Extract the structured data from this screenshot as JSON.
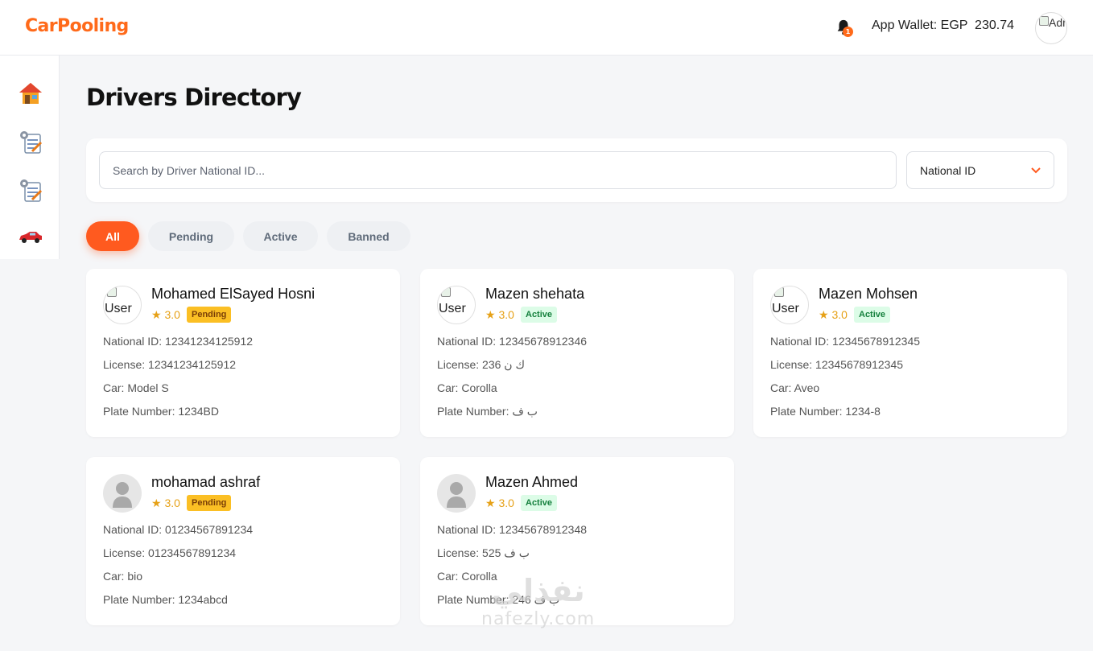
{
  "app": {
    "logo": "CarPooling"
  },
  "header": {
    "wallet_label": "App Wallet: EGP  230.74",
    "notification_count": "1",
    "admin_avatar_alt": "Admin"
  },
  "sidebar": {
    "items": [
      {
        "icon": "home-icon"
      },
      {
        "icon": "settings-clipboard-icon"
      },
      {
        "icon": "settings-clipboard-icon"
      },
      {
        "icon": "car-icon"
      }
    ]
  },
  "page": {
    "title": "Drivers Directory"
  },
  "search": {
    "placeholder": "Search by Driver National ID...",
    "filter_selected": "National ID"
  },
  "tabs": [
    {
      "label": "All",
      "active": true
    },
    {
      "label": "Pending",
      "active": false
    },
    {
      "label": "Active",
      "active": false
    },
    {
      "label": "Banned",
      "active": false
    }
  ],
  "drivers": [
    {
      "name": "Mohamed ElSayed Hosni",
      "avatar_alt": "User",
      "rating": "★ 3.0",
      "status": "Pending",
      "national_id": "National ID: 12341234125912",
      "license": "License: 12341234125912",
      "car": "Car: Model S",
      "plate": "Plate Number: 1234BD"
    },
    {
      "name": "Mazen shehata",
      "avatar_alt": "User",
      "rating": "★ 3.0",
      "status": "Active",
      "national_id": "National ID: 12345678912346",
      "license": "License: 236 ك ن",
      "car": "Car: Corolla",
      "plate": "Plate Number: ب ف"
    },
    {
      "name": "Mazen Mohsen",
      "avatar_alt": "User",
      "rating": "★ 3.0",
      "status": "Active",
      "national_id": "National ID: 12345678912345",
      "license": "License: 12345678912345",
      "car": "Car: Aveo",
      "plate": "Plate Number: 1234-8"
    },
    {
      "name": "mohamad ashraf",
      "avatar_alt": "",
      "rating": "★ 3.0",
      "status": "Pending",
      "national_id": "National ID: 01234567891234",
      "license": "License: 01234567891234",
      "car": "Car: bio",
      "plate": "Plate Number: 1234abcd"
    },
    {
      "name": "Mazen Ahmed",
      "avatar_alt": "",
      "rating": "★ 3.0",
      "status": "Active",
      "national_id": "National ID: 12345678912348",
      "license": "License: 525 ب ف",
      "car": "Car: Corolla",
      "plate": "Plate Number: 246 ب ف"
    }
  ],
  "watermark": {
    "arabic": "نفذلي",
    "latin": "nafezly.com"
  },
  "colors": {
    "brand": "#ff6a1a",
    "accent": "#ff5a1f",
    "pending": "#fbbf24",
    "active_bg": "#dcfce7",
    "active_text": "#15803d",
    "star": "#e6a117"
  }
}
